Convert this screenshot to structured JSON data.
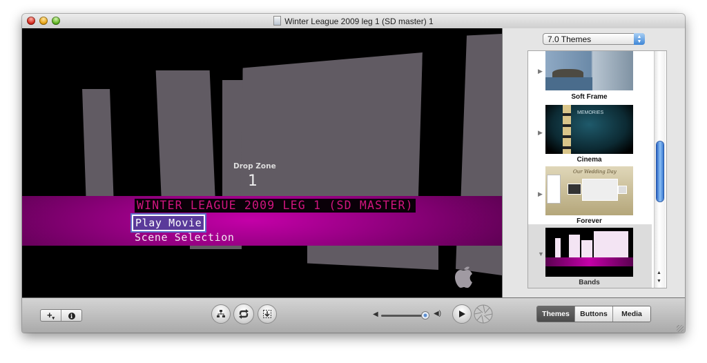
{
  "window": {
    "title": "Winter League 2009 leg 1 (SD master) 1"
  },
  "preview": {
    "drop_zone_label": "Drop Zone",
    "drop_zone_number": "1",
    "menu_title": "WINTER LEAGUE 2009 LEG 1 (SD MASTER)",
    "menu_items": [
      "Play Movie",
      "Scene Selection"
    ],
    "selected_item": "Play Movie",
    "band_color": "#c400a8"
  },
  "sidebar": {
    "theme_set": "7.0 Themes",
    "themes": [
      {
        "name": "Soft Frame",
        "expanded": false,
        "selected": false
      },
      {
        "name": "Cinema",
        "expanded": false,
        "selected": false
      },
      {
        "name": "Forever",
        "expanded": false,
        "selected": false
      },
      {
        "name": "Bands",
        "expanded": true,
        "selected": true
      }
    ],
    "cinema_thumb_heading": "MEMORIES",
    "forever_thumb_heading": "Our Wedding Day"
  },
  "toolbar": {
    "add_label": "+",
    "info_label": "i",
    "volume_level": 0.95,
    "tabs": [
      {
        "label": "Themes",
        "active": true
      },
      {
        "label": "Buttons",
        "active": false
      },
      {
        "label": "Media",
        "active": false
      }
    ]
  }
}
